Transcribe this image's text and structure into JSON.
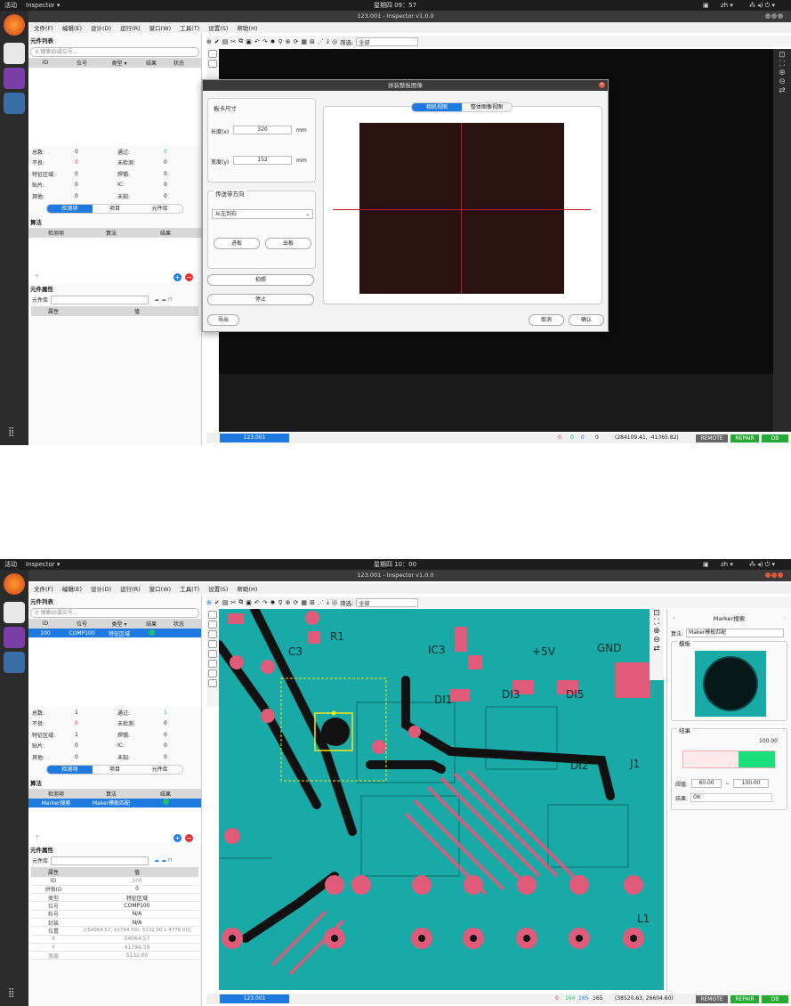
{
  "screens": [
    {
      "topbar": {
        "activities": "活动",
        "app": "Inspector ▾",
        "clock": "星期四 09：57",
        "tray": "zh ▾"
      },
      "window_title": "123.001 - Inspector v1.0.0",
      "menu": [
        "文件(F)",
        "编辑(E)",
        "设计(D)",
        "运行(R)",
        "窗口(W)",
        "工具(T)",
        "设置(S)",
        "帮助(H)"
      ],
      "filter_label": "筛选:",
      "filter_value": "全部",
      "component_list": {
        "title": "元件列表",
        "search_placeholder": "搜索ID或位号...",
        "headers": [
          "ID",
          "位号",
          "类型 ▾",
          "结果",
          "状态"
        ]
      },
      "stats": [
        [
          "总数:",
          "0",
          "通过:",
          "0"
        ],
        [
          "不良:",
          "0",
          "未检测:",
          "0"
        ],
        [
          "特征区域:",
          "0",
          "焊锡:",
          "0"
        ],
        [
          "贴片:",
          "0",
          "IC:",
          "0"
        ],
        [
          "其他:",
          "0",
          "未知:",
          "0"
        ]
      ],
      "tabs": [
        "检测项",
        "项目",
        "元件库"
      ],
      "algorithm": {
        "title": "算法",
        "headers": [
          "检测项",
          "算法",
          "结果"
        ]
      },
      "attributes": {
        "title": "元件属性",
        "lib_label": "元件库",
        "headers": [
          "属性",
          "值"
        ]
      },
      "status": {
        "doc": "123.001",
        "counts": [
          "0",
          "0",
          "0",
          "0"
        ],
        "coords": "(284109.41, -41365.82)",
        "remote": "REMOTE",
        "repair": "REPAIR",
        "db": "DB"
      },
      "dialog": {
        "title": "拼装整板图像",
        "board_size": "板卡尺寸",
        "length_label": "长度(x)",
        "length_value": "320",
        "width_label": "宽度(y)",
        "width_value": "152",
        "unit": "mm",
        "direction_title": "传送带方向",
        "direction_value": "从左到右",
        "btn_in": "进板",
        "btn_out": "出板",
        "btn_shoot": "拍照",
        "btn_stop": "停止",
        "btn_export": "导出",
        "btn_cancel": "取消",
        "btn_ok": "确认",
        "view_tabs": [
          "相机视图",
          "整体图像视图"
        ]
      }
    },
    {
      "topbar": {
        "activities": "活动",
        "app": "Inspector ▾",
        "clock": "星期四 10：00",
        "tray": "zh ▾"
      },
      "window_title": "123.001 - Inspector v1.0.0",
      "menu": [
        "文件(F)",
        "编辑(E)",
        "设计(D)",
        "运行(R)",
        "窗口(W)",
        "工具(T)",
        "设置(S)",
        "帮助(H)"
      ],
      "filter_label": "筛选:",
      "filter_value": "全部",
      "component_list": {
        "title": "元件列表",
        "search_placeholder": "搜索ID或位号...",
        "headers": [
          "ID",
          "位号",
          "类型 ▾",
          "结果",
          "状态"
        ],
        "rows": [
          [
            "100",
            "COMP100",
            "特征区域"
          ]
        ]
      },
      "stats": [
        [
          "总数:",
          "1",
          "通过:",
          "1"
        ],
        [
          "不良:",
          "0",
          "未检测:",
          "0"
        ],
        [
          "特征区域:",
          "1",
          "焊锡:",
          "0"
        ],
        [
          "贴片:",
          "0",
          "IC:",
          "0"
        ],
        [
          "其他:",
          "0",
          "未知:",
          "0"
        ]
      ],
      "tabs": [
        "检测项",
        "项目",
        "元件库"
      ],
      "algorithm": {
        "title": "算法",
        "headers": [
          "检测项",
          "算法",
          "结果"
        ],
        "rows": [
          [
            "Marker搜索",
            "Maker模板匹配"
          ]
        ]
      },
      "attributes": {
        "title": "元件属性",
        "lib_label": "元件库",
        "headers": [
          "属性",
          "值"
        ],
        "rows": [
          [
            "ID",
            "100"
          ],
          [
            "拼板ID",
            "0"
          ],
          [
            "类型",
            "特征区域"
          ],
          [
            "位号",
            "COMP100"
          ],
          [
            "料号",
            "N/A"
          ],
          [
            "封装",
            "N/A"
          ],
          [
            "位置",
            "[(54064.57, 41794.59), 5132.00 x 4778.00]"
          ],
          [
            "X",
            "54064.57"
          ],
          [
            "Y",
            "41794.59"
          ],
          [
            "宽度",
            "5132.00"
          ]
        ]
      },
      "pcb_labels": [
        "+5V",
        "IC3",
        "GND",
        "C3",
        "R1",
        "DI1",
        "DI3",
        "DI5",
        "DI2",
        "J1",
        "L1"
      ],
      "marker_panel": {
        "title": "Marker搜索",
        "algo_label": "算法:",
        "algo_value": "Maker模板匹配",
        "template_title": "模板",
        "result_title": "结果",
        "score": "100.00",
        "thresh_label": "阈值:",
        "thresh_min": "60.00",
        "thresh_sep": "~",
        "thresh_max": "100.00",
        "result_label": "结果:",
        "result_value": "OK"
      },
      "status": {
        "doc": "123.001",
        "counts": [
          "0",
          "164",
          "165",
          "165"
        ],
        "coords": "(38520.63, 26604.60)",
        "remote": "REMOTE",
        "repair": "REPAIR",
        "db": "DB"
      }
    }
  ],
  "colors": {
    "accent": "#1e7ae0",
    "pcb": "#19a9a6",
    "pad": "#e05a7a",
    "trace": "#111111",
    "ok": "#19c36b",
    "remote": "#666666",
    "repair": "#22aa33"
  }
}
